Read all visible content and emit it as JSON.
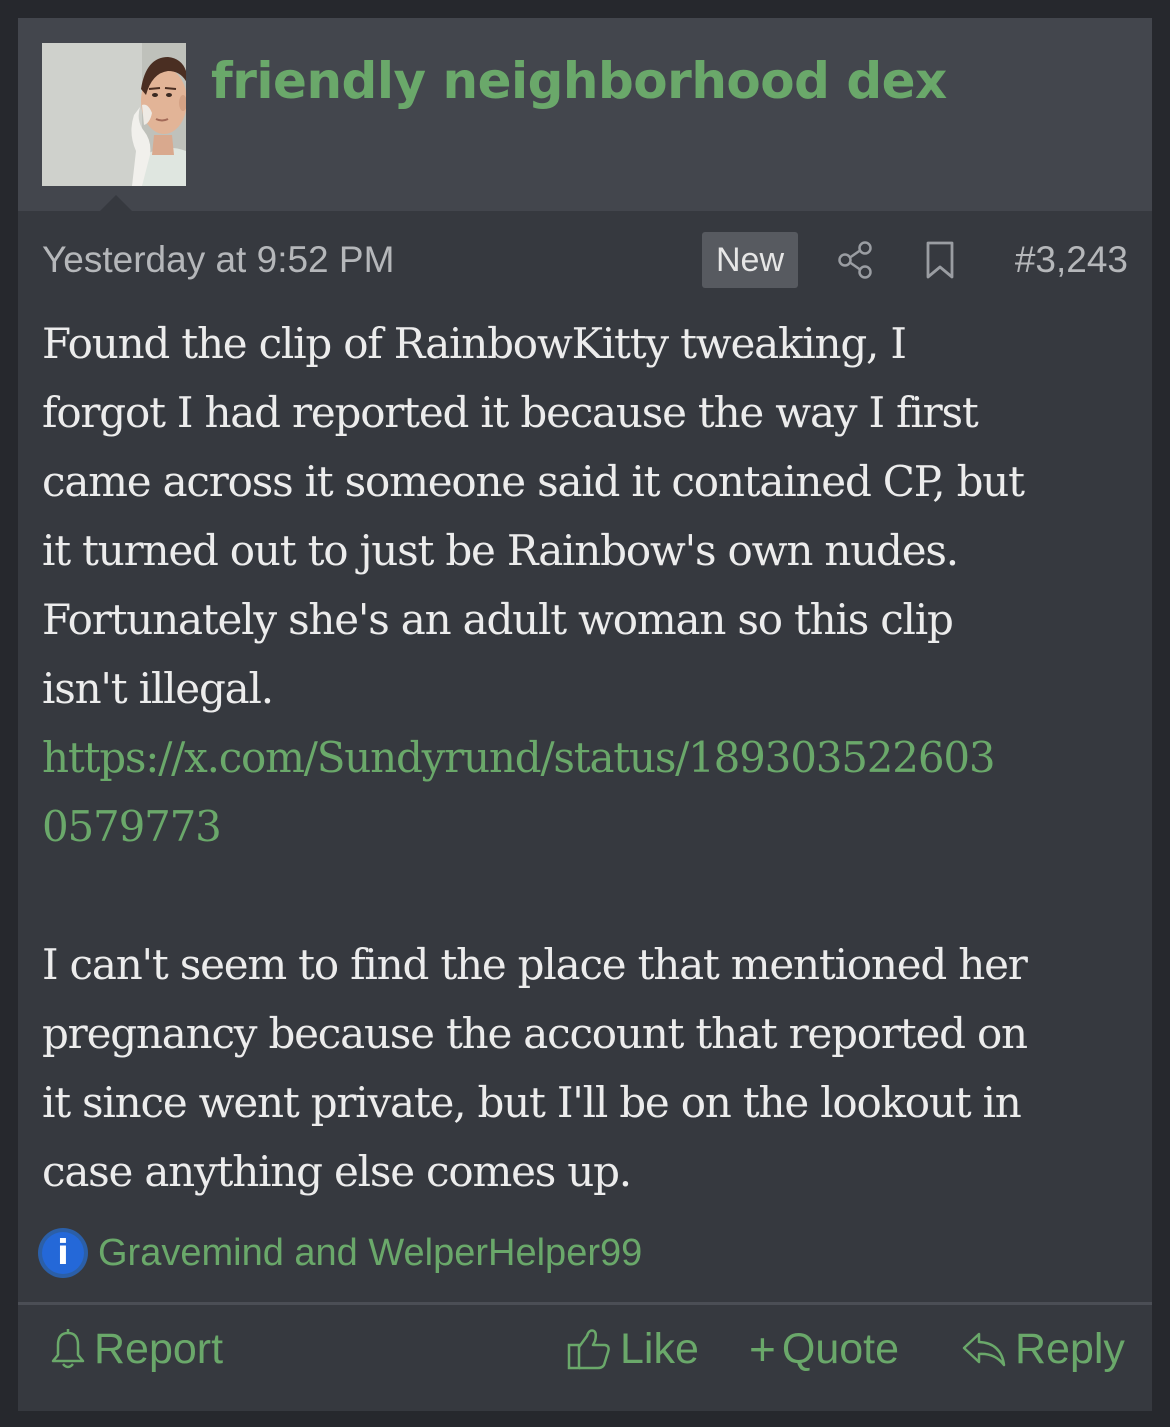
{
  "post": {
    "author": {
      "username": "friendly neighborhood dex"
    },
    "timestamp": "Yesterday at 9:52 PM",
    "new_badge": "New",
    "post_number": "#3,243",
    "body": {
      "paragraph1_lines": [
        "Found the clip of RainbowKitty tweaking, I",
        "forgot I had reported it because the way I first",
        "came across it someone said it contained CP, but",
        "it turned out to just be Rainbow's own nudes.",
        "Fortunately she's an adult woman so this clip",
        "isn't illegal."
      ],
      "link_lines": [
        "https://x.com/Sundyrund/status/189303522603",
        "0579773"
      ],
      "paragraph2_lines": [
        "I can't seem to find the place that mentioned her",
        "pregnancy because the account that reported on",
        "it since went private, but I'll be on the lookout in",
        "case anything else comes up."
      ]
    },
    "reactions": {
      "icon": "info-icon",
      "users": "Gravemind and WelperHelper99"
    },
    "actions": {
      "report": "Report",
      "like": "Like",
      "quote": "Quote",
      "reply": "Reply"
    }
  },
  "colors": {
    "accent": "#6aa86a",
    "panel": "#36393f",
    "header": "#43464d",
    "text": "#ececec",
    "muted": "#b5b7ba",
    "reaction_blue": "#2468d8"
  }
}
